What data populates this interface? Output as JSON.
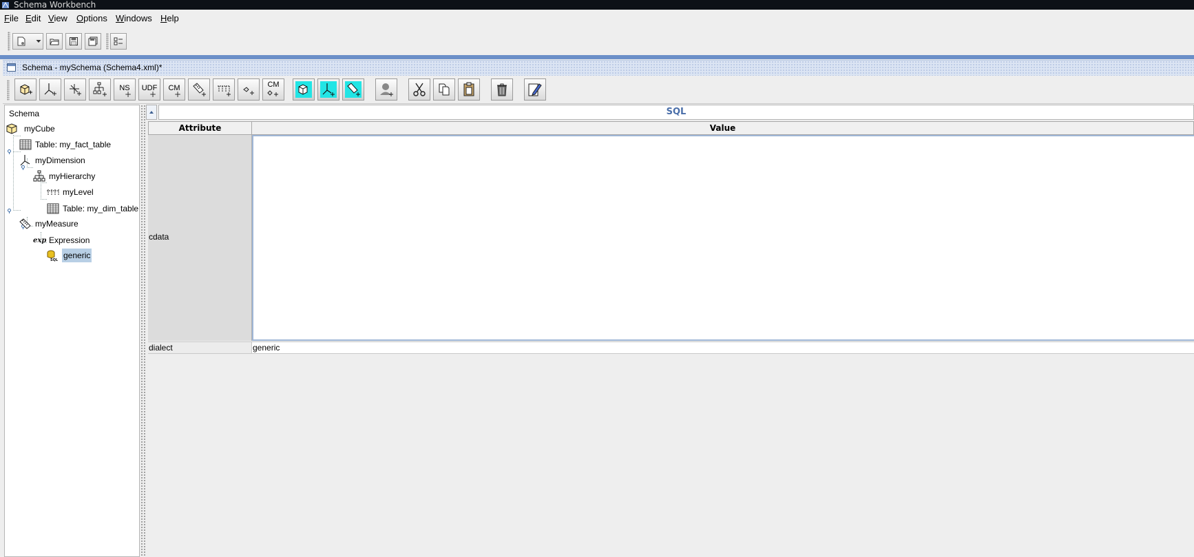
{
  "window": {
    "title": "Schema Workbench"
  },
  "menubar": {
    "items": [
      {
        "label": "File",
        "mnemonic": "F",
        "rest": "ile"
      },
      {
        "label": "Edit",
        "mnemonic": "E",
        "rest": "dit"
      },
      {
        "label": "View",
        "mnemonic": "V",
        "rest": "iew"
      },
      {
        "label": "Options",
        "mnemonic": "O",
        "rest": "ptions"
      },
      {
        "label": "Windows",
        "mnemonic": "W",
        "rest": "indows"
      },
      {
        "label": "Help",
        "mnemonic": "H",
        "rest": "elp"
      }
    ]
  },
  "main_toolbar": {
    "icons": [
      "new-document-icon",
      "dropdown-arrow-icon",
      "open-folder-icon",
      "save-icon",
      "save-as-icon",
      "preferences-icon"
    ]
  },
  "frame": {
    "title": "Schema - mySchema (Schema4.xml)*"
  },
  "schema_toolbar": {
    "text_buttons": {
      "ns": "NS",
      "udf": "UDF",
      "cm": "CM",
      "cm2": "CM"
    },
    "icons": [
      "add-cube-icon",
      "add-dimension-icon",
      "add-dimension-usage-icon",
      "add-hierarchy-icon",
      "add-named-set-icon",
      "add-udf-icon",
      "add-calculated-member-icon",
      "add-measure-icon",
      "add-level-icon",
      "add-property-icon",
      "add-calculated-member-property-icon",
      "add-virtual-cube-icon",
      "add-virtual-dimension-icon",
      "add-virtual-measure-icon",
      "add-role-icon",
      "cut-icon",
      "copy-icon",
      "paste-icon",
      "delete-icon",
      "edit-icon"
    ]
  },
  "tree": {
    "root": "Schema",
    "nodes": {
      "cube": "myCube",
      "fact_table": "Table: my_fact_table",
      "dimension": "myDimension",
      "hierarchy": "myHierarchy",
      "level": "myLevel",
      "dim_table": "Table: my_dim_table",
      "measure": "myMeasure",
      "expression": "Expression",
      "sql": "generic"
    }
  },
  "details": {
    "title": "SQL",
    "columns": {
      "attribute": "Attribute",
      "value": "Value"
    },
    "rows": {
      "cdata": {
        "attribute": "cdata",
        "value": ""
      },
      "dialect": {
        "attribute": "dialect",
        "value": "generic"
      }
    }
  },
  "colors": {
    "accent_blue": "#6b8fc8",
    "selection": "#b8cfe5",
    "title_blue": "#4a6ea9",
    "toggle_cyan": "#22e5e5"
  }
}
